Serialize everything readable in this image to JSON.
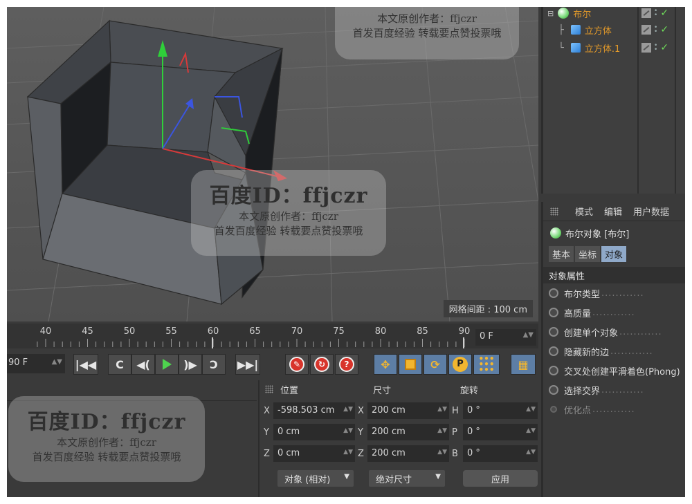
{
  "viewport": {
    "grid_spacing": "网格间距 : 100 cm"
  },
  "object_manager": {
    "objects": [
      {
        "name": "布尔",
        "icon": "boole-icon"
      },
      {
        "name": "立方体",
        "icon": "cube-icon"
      },
      {
        "name": "立方体.1",
        "icon": "cube-icon"
      }
    ]
  },
  "attribute_manager": {
    "menu": [
      "模式",
      "编辑",
      "用户数据"
    ],
    "object_title": "布尔对象 [布尔]",
    "tabs": [
      "基本",
      "坐标",
      "对象"
    ],
    "active_tab": "对象",
    "section": "对象属性",
    "properties": [
      "布尔类型",
      "高质量",
      "创建单个对象",
      "隐藏新的边",
      "交叉处创建平滑着色(Phong)",
      "选择交界",
      "优化点"
    ],
    "leader": "............"
  },
  "timeline": {
    "ticks": [
      "40",
      "45",
      "50",
      "55",
      "60",
      "65",
      "70",
      "75",
      "80",
      "85",
      "90"
    ],
    "current_frame": "0 F",
    "end_frame": "90 F"
  },
  "transport": {
    "buttons": [
      "go-to-start",
      "previous-key",
      "previous-frame",
      "play",
      "next-frame",
      "next-key",
      "go-to-end"
    ],
    "record": [
      "record-icon",
      "autokey-icon",
      "help-icon"
    ],
    "tools": [
      "move-icon",
      "scale-icon",
      "rotate-icon",
      "param-icon",
      "points-icon",
      "film-icon"
    ]
  },
  "coordinates": {
    "headers": {
      "position": "位置",
      "size": "尺寸",
      "rotation": "旋转"
    },
    "rows": [
      {
        "pos_axis": "X",
        "pos": "-598.503 cm",
        "size_axis": "X",
        "size": "200 cm",
        "rot_axis": "H",
        "rot": "0 °"
      },
      {
        "pos_axis": "Y",
        "pos": "0 cm",
        "size_axis": "Y",
        "size": "200 cm",
        "rot_axis": "P",
        "rot": "0 °"
      },
      {
        "pos_axis": "Z",
        "pos": "0 cm",
        "size_axis": "Z",
        "size": "200 cm",
        "rot_axis": "B",
        "rot": "0 °"
      }
    ],
    "mode_dropdown": "对象 (相对)",
    "size_dropdown": "绝对尺寸",
    "apply": "应用"
  },
  "watermark": {
    "id": "百度ID：ffjczr",
    "author": "本文原创作者：ffjczr",
    "note": "首发百度经验 转载要点赞投票哦"
  },
  "colors": {
    "accent_orange": "#e39a2a",
    "active_tab": "#8fa9c9",
    "play_green": "#4ed34e",
    "record_red": "#d8342b"
  }
}
